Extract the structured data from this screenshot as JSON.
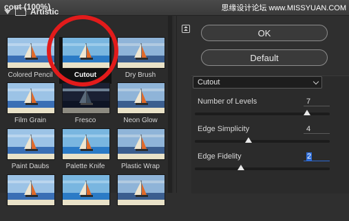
{
  "window": {
    "title": "cout (100%)",
    "watermark": "思缘设计论坛 www.MISSYUAN.COM"
  },
  "gallery": {
    "category": "Artistic",
    "filters": [
      {
        "label": "Colored Pencil",
        "icon": "colored-pencil-thumbnail"
      },
      {
        "label": "Cutout",
        "icon": "cutout-thumbnail",
        "selected": true
      },
      {
        "label": "Dry Brush",
        "icon": "dry-brush-thumbnail"
      },
      {
        "label": "Film Grain",
        "icon": "film-grain-thumbnail"
      },
      {
        "label": "Fresco",
        "icon": "fresco-thumbnail"
      },
      {
        "label": "Neon Glow",
        "icon": "neon-glow-thumbnail"
      },
      {
        "label": "Paint Daubs",
        "icon": "paint-daubs-thumbnail"
      },
      {
        "label": "Palette Knife",
        "icon": "palette-knife-thumbnail"
      },
      {
        "label": "Plastic Wrap",
        "icon": "plastic-wrap-thumbnail"
      }
    ]
  },
  "buttons": {
    "ok": "OK",
    "default": "Default"
  },
  "filter_select": {
    "value": "Cutout"
  },
  "params": [
    {
      "label": "Number of Levels",
      "value": "7",
      "level": 0.83
    },
    {
      "label": "Edge Simplicity",
      "value": "4",
      "level": 0.4
    },
    {
      "label": "Edge Fidelity",
      "value": "2",
      "level": 0.34,
      "active": true
    }
  ],
  "colors": {
    "highlight_circle": "#e21b1b",
    "selection_blue": "#2d6bd6"
  }
}
